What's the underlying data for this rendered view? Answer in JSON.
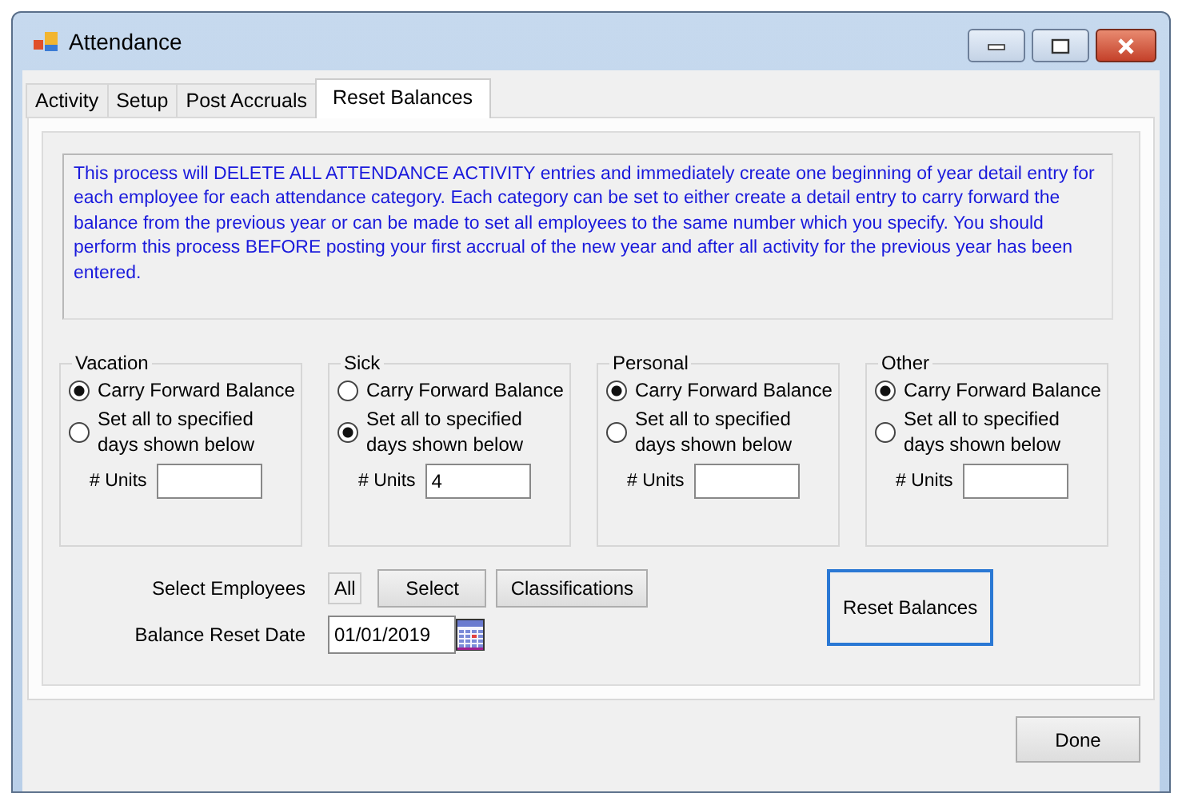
{
  "window": {
    "title": "Attendance"
  },
  "tabs": [
    {
      "label": "Activity",
      "selected": false
    },
    {
      "label": "Setup",
      "selected": false
    },
    {
      "label": "Post Accruals",
      "selected": false
    },
    {
      "label": "Reset Balances",
      "selected": true
    }
  ],
  "description": "This process will DELETE ALL ATTENDANCE ACTIVITY entries and immediately create one beginning of year detail entry for each employee for each attendance category. Each category can be set to either create a detail entry to carry forward the balance from the previous year or can be made to set all employees to the same number which you specify. You should perform this process BEFORE posting your first accrual of the new year and after all activity for the previous year has been entered.",
  "categories": [
    {
      "title": "Vacation",
      "options": [
        {
          "label": "Carry Forward Balance",
          "selected": true
        },
        {
          "label": "Set all to specified days shown below",
          "selected": false
        }
      ],
      "units_label": "# Units"
    },
    {
      "title": "Sick",
      "options": [
        {
          "label": "Carry Forward Balance",
          "selected": false
        },
        {
          "label": "Set all to specified days shown below",
          "selected": true
        }
      ],
      "units_label": "# Units",
      "units": "4"
    },
    {
      "title": "Personal",
      "options": [
        {
          "label": "Carry Forward Balance",
          "selected": true
        },
        {
          "label": "Set all to specified days shown below",
          "selected": false
        }
      ],
      "units_label": "# Units"
    },
    {
      "title": "Other",
      "options": [
        {
          "label": "Carry Forward Balance",
          "selected": true
        },
        {
          "label": "Set all to specified days shown below",
          "selected": false
        }
      ],
      "units_label": "# Units"
    }
  ],
  "select_employees": {
    "label": "Select Employees",
    "value": "All",
    "buttons": [
      "Select",
      "Classifications"
    ]
  },
  "reset_date": {
    "label": "Balance Reset Date",
    "value": "01/01/2019"
  },
  "reset_button": "Reset Balances",
  "done_button": "Done"
}
